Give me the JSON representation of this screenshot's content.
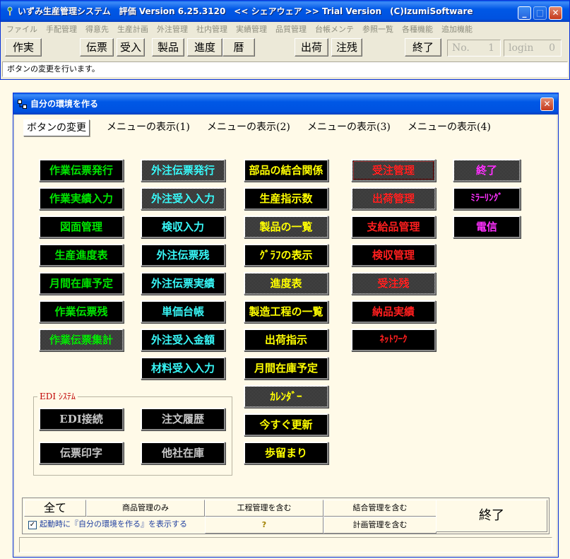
{
  "app": {
    "title": "いずみ生産管理システム　評価 Version 6.25.3120　<< シェアウェア >> Trial Version　(C)IzumiSoftware",
    "window_buttons": {
      "minimize": "_",
      "maximize": "□",
      "close": "✕"
    },
    "menu": [
      "ファイル",
      "手配管理",
      "得意先",
      "生産計画",
      "外注管理",
      "社内管理",
      "実績管理",
      "品質管理",
      "台帳メンテ",
      "参照一覧",
      "各種機能",
      "追加機能"
    ],
    "toolbar": {
      "sakujitsu": "作実",
      "denpyo": "伝票",
      "ukeire": "受入",
      "seihin": "製品",
      "shinchoku": "進度",
      "koyomi": "暦",
      "shukka": "出荷",
      "chuzan": "注残",
      "shuryo": "終了",
      "no_label": "No.",
      "no_value": "1",
      "login_label": "login",
      "login_value": "0"
    },
    "status": "ボタンの変更を行います。"
  },
  "dialog": {
    "title": "自分の環境を作る",
    "close": "✕",
    "tabs": [
      "ボタンの変更",
      "メニューの表示(1)",
      "メニューの表示(2)",
      "メニューの表示(3)",
      "メニューの表示(4)"
    ],
    "columns": {
      "col1": [
        "作業伝票発行",
        "作業実績入力",
        "図面管理",
        "生産進度表",
        "月間在庫予定",
        "作業伝票残",
        "作業伝票集計"
      ],
      "col2": [
        "外注伝票発行",
        "外注受入入力",
        "検収入力",
        "外注伝票残",
        "外注伝票実績",
        "単価台帳",
        "外注受入金額",
        "材料受入入力"
      ],
      "col3": [
        "部品の結合関係",
        "生産指示数",
        "製品の一覧",
        "ｸﾞﾗﾌの表示",
        "進度表",
        "製造工程の一覧",
        "出荷指示",
        "月間在庫予定",
        "ｶﾚﾝﾀﾞｰ",
        "今すぐ更新",
        "歩留まり"
      ],
      "col4": [
        "受注管理",
        "出荷管理",
        "支給品管理",
        "検収管理",
        "受注残",
        "納品実績",
        "ﾈｯﾄﾜｰｸ"
      ],
      "col5": [
        "終了",
        "ﾐﾗｰﾘﾝｸﾞ",
        "電信"
      ]
    },
    "edi": {
      "legend": "EDI ｼｽﾃﾑ",
      "buttons": [
        "EDI接続",
        "注文履歴",
        "伝票印字",
        "他社在庫"
      ]
    },
    "bottom": {
      "all": "全て",
      "opt1": "商品管理のみ",
      "opt2": "工程管理を含む",
      "opt3": "結合管理を含む",
      "opt4": "計画管理を含む",
      "help": "?",
      "checkbox_label": "起動時に『自分の環境を作る』を表示する",
      "checkbox_mark": "✓",
      "end": "終了"
    }
  },
  "colors": {
    "xp_blue": "#0058E6",
    "green_text": "#00E600",
    "cyan_text": "#38F8F8",
    "yellow_text": "#FFFF00",
    "red_text": "#FF1E1E",
    "magenta_text": "#FF30FF",
    "edi_legend": "#C00000"
  }
}
